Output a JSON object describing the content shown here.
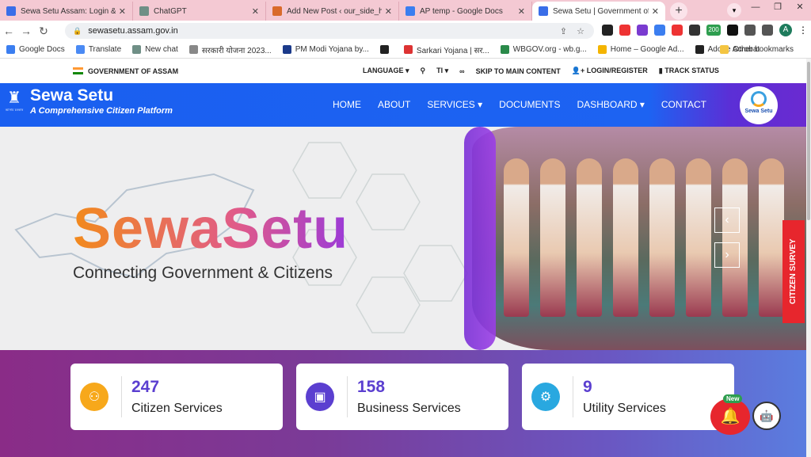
{
  "browser": {
    "tabs": [
      {
        "title": "Sewa Setu Assam: Login & Re",
        "icon_color": "#3a6ee8"
      },
      {
        "title": "ChatGPT",
        "icon_color": "#6f8f86"
      },
      {
        "title": "Add New Post ‹ our_side_hust",
        "icon_color": "#d96a2a"
      },
      {
        "title": "AP temp - Google Docs",
        "icon_color": "#3b7ef0"
      },
      {
        "title": "Sewa Setu | Government of As",
        "icon_color": "#3a6ee8",
        "active": true
      }
    ],
    "new_tab": "+",
    "window_controls": [
      "—",
      "❐",
      "✕"
    ],
    "url": "sewasetu.assam.gov.in",
    "bookmarks": [
      {
        "label": "Google Docs",
        "icon_color": "#3b7ef0"
      },
      {
        "label": "Translate",
        "icon_color": "#4a8af4"
      },
      {
        "label": "New chat",
        "icon_color": "#6f8f86"
      },
      {
        "label": "सरकारी योजना 2023...",
        "icon_color": "#888"
      },
      {
        "label": "PM Modi Yojana by...",
        "icon_color": "#1b3a8a"
      },
      {
        "label": "",
        "icon_color": "#222"
      },
      {
        "label": "Sarkari Yojana | सर...",
        "icon_color": "#d33"
      },
      {
        "label": "WBGOV.org - wb.g...",
        "icon_color": "#2a8a4a"
      },
      {
        "label": "Home – Google Ad...",
        "icon_color": "#f4b400"
      },
      {
        "label": "Adobe Acrobat",
        "icon_color": "#222"
      }
    ],
    "other_bookmarks": "Other bookmarks",
    "profile_initial": "A",
    "ext_badge": "200"
  },
  "site": {
    "gov_label": "GOVERNMENT OF ASSAM",
    "top_links": [
      "LANGUAGE ▾",
      "⚲",
      "TI ▾",
      "∞",
      "SKIP TO MAIN CONTENT",
      "LOGIN/REGISTER",
      "TRACK STATUS"
    ],
    "brand_name": "Sewa Setu",
    "brand_tagline": "A Comprehensive Citizen Platform",
    "emblem_caption": "আসাম চৰকাৰ",
    "menu": [
      "HOME",
      "ABOUT",
      "SERVICES ▾",
      "DOCUMENTS",
      "DASHBOARD ▾",
      "CONTACT"
    ],
    "logo_text": "Sewa Setu",
    "hero_title": "SewaSetu",
    "hero_subtitle": "Connecting Government & Citizens",
    "survey_label": "CITIZEN SURVEY",
    "stats": [
      {
        "value": "247",
        "label": "Citizen Services",
        "icon_color": "#f7a81b"
      },
      {
        "value": "158",
        "label": "Business Services",
        "icon_color": "#5b3fd0"
      },
      {
        "value": "9",
        "label": "Utility Services",
        "icon_color": "#29a8e0"
      }
    ],
    "new_badge": "New"
  }
}
